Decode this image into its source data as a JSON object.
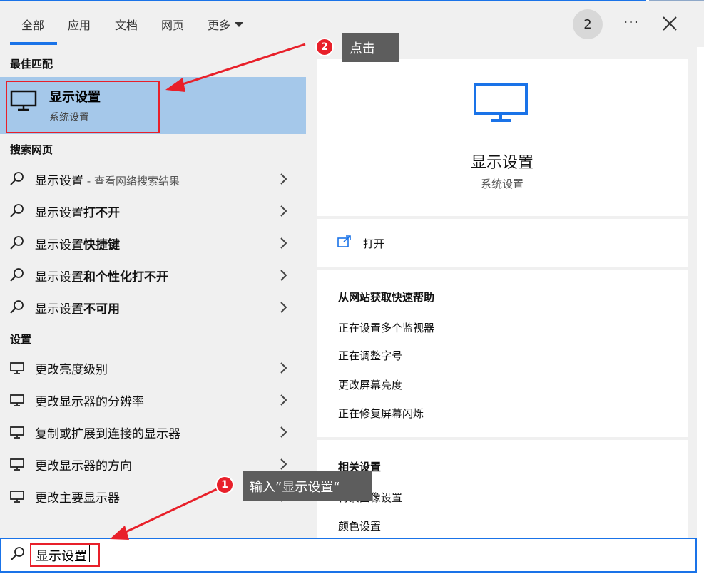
{
  "tabs": [
    {
      "label": "全部",
      "active": true
    },
    {
      "label": "应用"
    },
    {
      "label": "文档"
    },
    {
      "label": "网页"
    },
    {
      "label": "更多"
    }
  ],
  "header": {
    "badge": "2",
    "more_dots": "···"
  },
  "sections": {
    "best_match": "最佳匹配",
    "web": "搜索网页",
    "settings": "设置"
  },
  "best_match": {
    "title": "显示设置",
    "subtitle": "系统设置"
  },
  "web_results": [
    {
      "prefix": "显示设置",
      "bold": "",
      "suffix": " - 查看网络搜索结果"
    },
    {
      "prefix": "显示设置",
      "bold": "打不开",
      "suffix": ""
    },
    {
      "prefix": "显示设置",
      "bold": "快捷键",
      "suffix": ""
    },
    {
      "prefix": "显示设置",
      "bold": "和个性化打不开",
      "suffix": ""
    },
    {
      "prefix": "显示设置",
      "bold": "不可用",
      "suffix": ""
    }
  ],
  "settings_results": [
    {
      "label": "更改亮度级别"
    },
    {
      "label": "更改显示器的分辨率"
    },
    {
      "label": "复制或扩展到连接的显示器"
    },
    {
      "label": "更改显示器的方向"
    },
    {
      "label": "更改主要显示器"
    }
  ],
  "preview": {
    "title": "显示设置",
    "subtitle": "系统设置",
    "open_label": "打开",
    "help_heading": "从网站获取快速帮助",
    "help_links": [
      "正在设置多个监视器",
      "正在调整字号",
      "更改屏幕亮度",
      "正在修复屏幕闪烁"
    ],
    "related_heading": "相关设置",
    "related_links": [
      "背景图像设置",
      "颜色设置"
    ]
  },
  "search": {
    "value": "显示设置"
  },
  "annotations": {
    "step1_num": "1",
    "step1_text": "输入”显示设置“",
    "step2_num": "2",
    "step2_text": "点击"
  },
  "colors": {
    "accent": "#1a73e8",
    "selection": "#a5c8ea",
    "annotation_red": "#e8202a"
  }
}
